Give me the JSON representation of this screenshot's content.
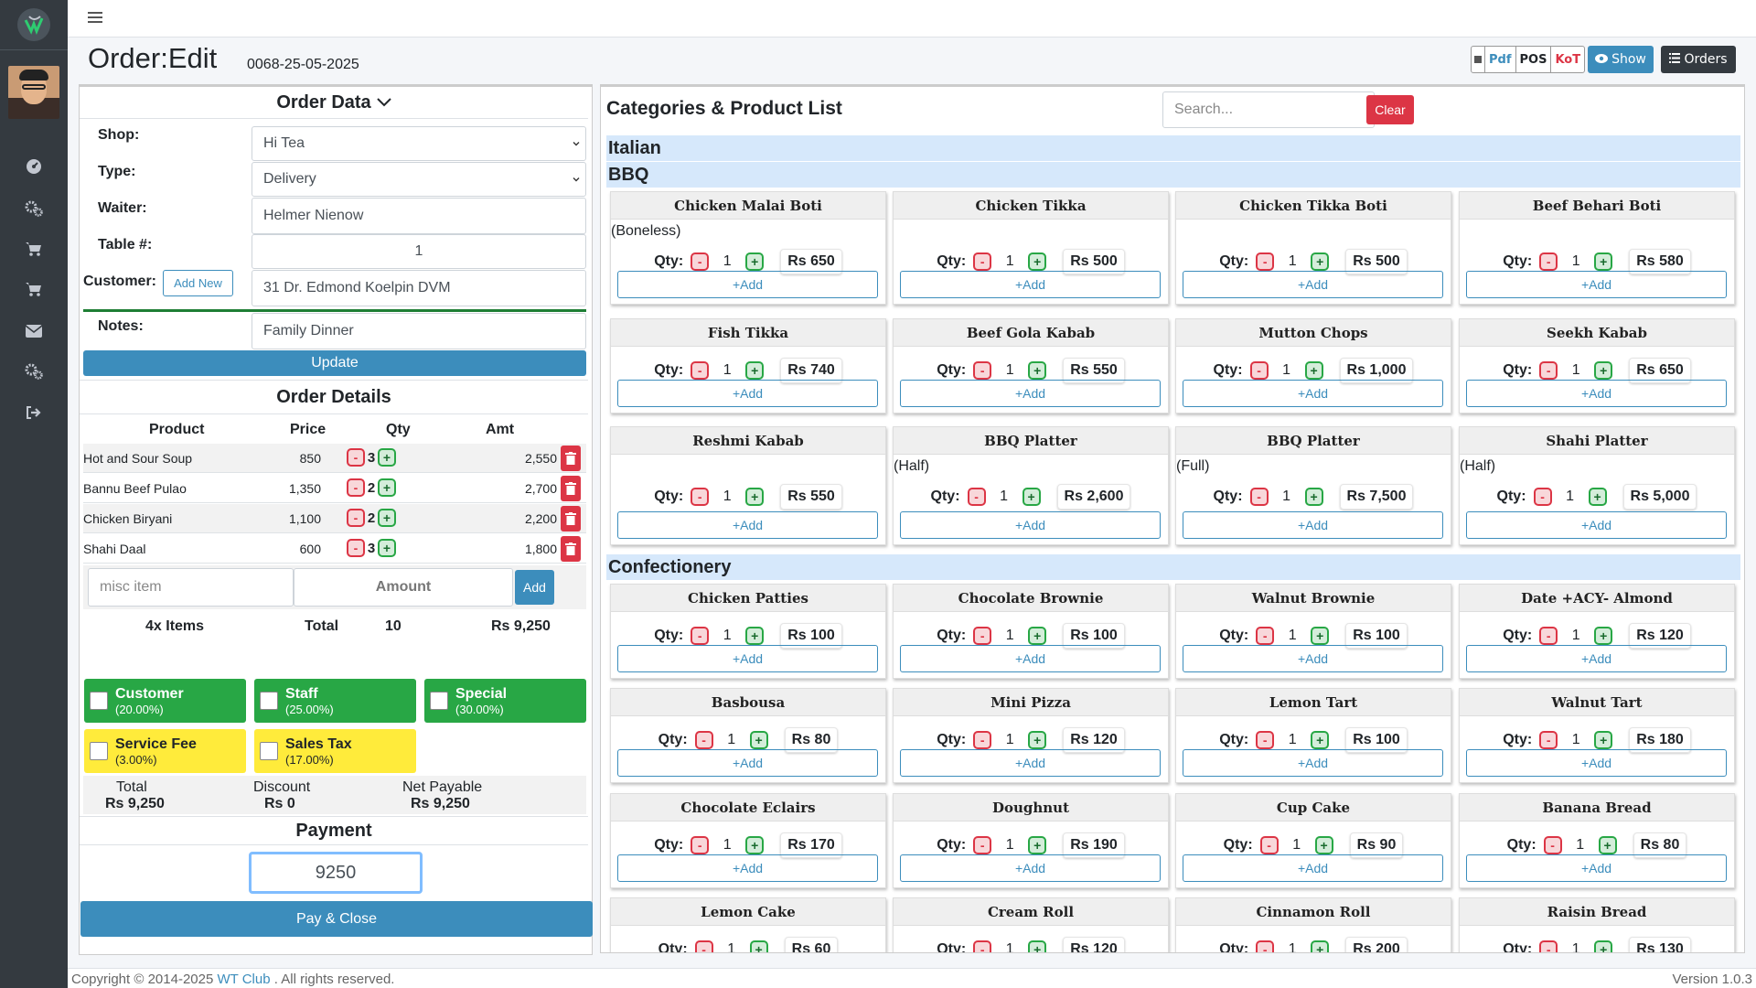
{
  "page": {
    "title": "Order:Edit",
    "order_number": "0068-25-05-2025"
  },
  "sidebar": {
    "items": [
      {
        "icon": "dashboard-icon"
      },
      {
        "icon": "cogs-icon"
      },
      {
        "icon": "cart-icon"
      },
      {
        "icon": "cart-icon"
      },
      {
        "icon": "envelope-icon"
      },
      {
        "icon": "cogs-icon"
      },
      {
        "icon": "sign-out-icon"
      }
    ]
  },
  "toolbar": {
    "pdf": "Pdf",
    "pos": "POS",
    "kot": "KoT",
    "show": "Show",
    "orders": "Orders"
  },
  "order_data": {
    "heading": "Order Data",
    "shop_label": "Shop:",
    "shop_value": "Hi Tea",
    "type_label": "Type:",
    "type_value": "Delivery",
    "waiter_label": "Waiter:",
    "waiter_value": "Helmer Nienow",
    "table_label": "Table #:",
    "table_value": "1",
    "customer_label": "Customer:",
    "add_new": "Add New",
    "customer_value": "31 Dr. Edmond Koelpin DVM",
    "notes_label": "Notes:",
    "notes_value": "Family Dinner",
    "update": "Update"
  },
  "order_details": {
    "heading": "Order Details",
    "columns": [
      "Product",
      "Price",
      "Qty",
      "Amt"
    ],
    "items": [
      {
        "product": "Hot and Sour Soup",
        "price": "850",
        "qty": "3",
        "amt": "2,550"
      },
      {
        "product": "Bannu Beef Pulao",
        "price": "1,350",
        "qty": "2",
        "amt": "2,700"
      },
      {
        "product": "Chicken Biryani",
        "price": "1,100",
        "qty": "2",
        "amt": "2,200"
      },
      {
        "product": "Shahi Daal",
        "price": "600",
        "qty": "3",
        "amt": "1,800"
      }
    ],
    "misc_placeholder": "misc item",
    "amount_placeholder": "Amount",
    "add": "Add",
    "items_count": "4x Items",
    "total_label": "Total",
    "total_qty": "10",
    "total_amt": "Rs 9,250"
  },
  "discounts": [
    {
      "name": "Customer",
      "pct": "(20.00%)",
      "color": "#28a745"
    },
    {
      "name": "Staff",
      "pct": "(25.00%)",
      "color": "#28a745"
    },
    {
      "name": "Special",
      "pct": "(30.00%)",
      "color": "#28a745"
    },
    {
      "name": "Service Fee",
      "pct": "(3.00%)",
      "color": "#ffeb3b"
    },
    {
      "name": "Sales Tax",
      "pct": "(17.00%)",
      "color": "#ffeb3b"
    }
  ],
  "summary": {
    "total_label": "Total",
    "total": "Rs 9,250",
    "discount_label": "Discount",
    "discount": "Rs 0",
    "net_label": "Net Payable",
    "net": "Rs 9,250"
  },
  "payment": {
    "heading": "Payment",
    "value": "9250",
    "pay_close": "Pay & Close"
  },
  "products": {
    "heading": "Categories & Product List",
    "search_placeholder": "Search...",
    "clear": "Clear",
    "qty_label": "Qty:",
    "add_label": "+Add",
    "categories": [
      {
        "name": "Italian",
        "items": []
      },
      {
        "name": "BBQ",
        "items": [
          {
            "name": "Chicken Malai Boti",
            "sub": "(Boneless)",
            "qty": "1",
            "price": "Rs 650"
          },
          {
            "name": "Chicken Tikka",
            "sub": "",
            "qty": "1",
            "price": "Rs 500"
          },
          {
            "name": "Chicken Tikka Boti",
            "sub": "",
            "qty": "1",
            "price": "Rs 500"
          },
          {
            "name": "Beef Behari Boti",
            "sub": "",
            "qty": "1",
            "price": "Rs 580"
          },
          {
            "name": "Fish Tikka",
            "sub": "",
            "qty": "1",
            "price": "Rs 740"
          },
          {
            "name": "Beef Gola Kabab",
            "sub": "",
            "qty": "1",
            "price": "Rs 550"
          },
          {
            "name": "Mutton Chops",
            "sub": "",
            "qty": "1",
            "price": "Rs 1,000"
          },
          {
            "name": "Seekh Kabab",
            "sub": "",
            "qty": "1",
            "price": "Rs 650"
          },
          {
            "name": "Reshmi Kabab",
            "sub": "",
            "qty": "1",
            "price": "Rs 550"
          },
          {
            "name": "BBQ Platter",
            "sub": "(Half)",
            "qty": "1",
            "price": "Rs 2,600"
          },
          {
            "name": "BBQ Platter",
            "sub": "(Full)",
            "qty": "1",
            "price": "Rs 7,500"
          },
          {
            "name": "Shahi Platter",
            "sub": "(Half)",
            "qty": "1",
            "price": "Rs 5,000"
          }
        ]
      },
      {
        "name": "Confectionery",
        "items": [
          {
            "name": "Chicken Patties",
            "sub": "",
            "qty": "1",
            "price": "Rs 100"
          },
          {
            "name": "Chocolate Brownie",
            "sub": "",
            "qty": "1",
            "price": "Rs 100"
          },
          {
            "name": "Walnut Brownie",
            "sub": "",
            "qty": "1",
            "price": "Rs 100"
          },
          {
            "name": "Date +ACY- Almond",
            "sub": "",
            "qty": "1",
            "price": "Rs 120"
          },
          {
            "name": "Basbousa",
            "sub": "",
            "qty": "1",
            "price": "Rs 80"
          },
          {
            "name": "Mini Pizza",
            "sub": "",
            "qty": "1",
            "price": "Rs 120"
          },
          {
            "name": "Lemon Tart",
            "sub": "",
            "qty": "1",
            "price": "Rs 100"
          },
          {
            "name": "Walnut Tart",
            "sub": "",
            "qty": "1",
            "price": "Rs 180"
          },
          {
            "name": "Chocolate Eclairs",
            "sub": "",
            "qty": "1",
            "price": "Rs 170"
          },
          {
            "name": "Doughnut",
            "sub": "",
            "qty": "1",
            "price": "Rs 190"
          },
          {
            "name": "Cup Cake",
            "sub": "",
            "qty": "1",
            "price": "Rs 90"
          },
          {
            "name": "Banana Bread",
            "sub": "",
            "qty": "1",
            "price": "Rs 80"
          },
          {
            "name": "Lemon Cake",
            "sub": "",
            "qty": "1",
            "price": "Rs 60"
          },
          {
            "name": "Cream Roll",
            "sub": "",
            "qty": "1",
            "price": "Rs 120"
          },
          {
            "name": "Cinnamon Roll",
            "sub": "",
            "qty": "1",
            "price": "Rs 200"
          },
          {
            "name": "Raisin Bread",
            "sub": "",
            "qty": "1",
            "price": "Rs 130"
          }
        ]
      }
    ]
  },
  "footer": {
    "copyright": "Copyright © 2014-2025 ",
    "brand": "WT Club",
    "rights": " . All rights reserved.",
    "version": "Version 1.0.3"
  }
}
